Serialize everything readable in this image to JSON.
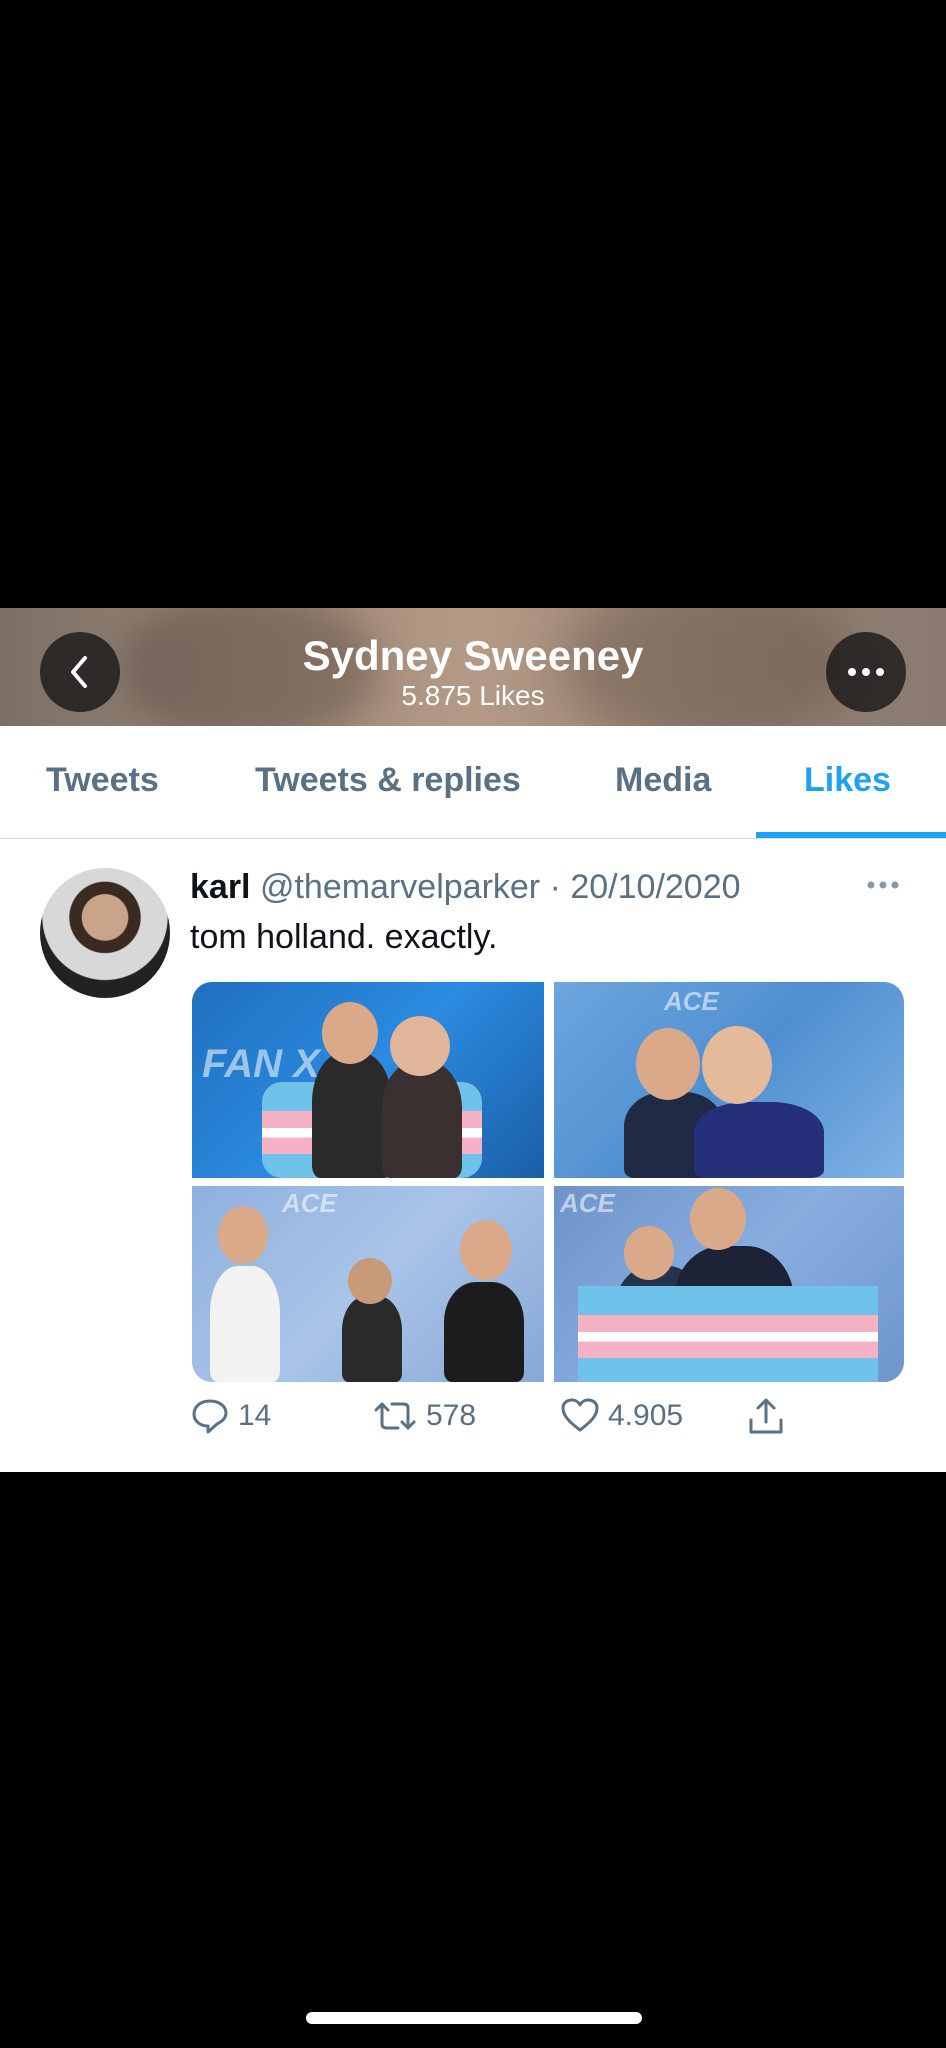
{
  "header": {
    "title": "Sydney Sweeney",
    "subtitle": "5.875 Likes"
  },
  "tabs": [
    {
      "label": "Tweets"
    },
    {
      "label": "Tweets & replies"
    },
    {
      "label": "Media"
    },
    {
      "label": "Likes"
    }
  ],
  "active_tab": "Likes",
  "tweet": {
    "name": "karl",
    "handle": "@themarvelparker",
    "separator": "·",
    "date": "20/10/2020",
    "text": "tom holland. exactly.",
    "replies": "14",
    "retweets": "578",
    "likes": "4.905",
    "photo_watermarks": [
      "FAN X",
      "ACE",
      "ACE",
      "ACE"
    ]
  },
  "icons": {
    "back": "chevron-left-icon",
    "more": "more-icon",
    "reply": "reply-icon",
    "retweet": "retweet-icon",
    "like": "heart-icon",
    "share": "share-icon"
  },
  "colors": {
    "accent": "#1da1f2",
    "secondary_text": "#5b7083",
    "primary_text": "#0f1419"
  }
}
